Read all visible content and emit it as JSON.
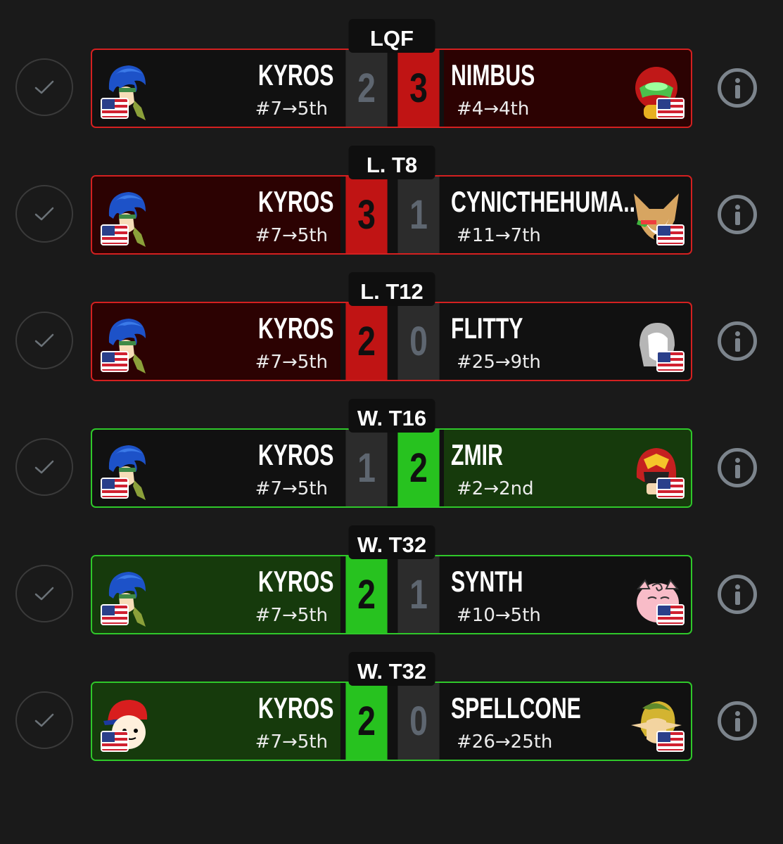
{
  "matches": [
    {
      "round": "LQF",
      "result": "loss",
      "p1": {
        "name": "KYROS",
        "seed": "#7→5th",
        "character": "ike-icon"
      },
      "p2": {
        "name": "NIMBUS",
        "seed": "#4→4th",
        "character": "samus-icon"
      },
      "score1": "2",
      "score2": "3"
    },
    {
      "round": "L. T8",
      "result": "win",
      "p1": {
        "name": "KYROS",
        "seed": "#7→5th",
        "character": "ike-icon"
      },
      "p2": {
        "name": "CYNICTHEHUMA...",
        "seed": "#11→7th",
        "character": "fox-icon"
      },
      "score1": "3",
      "score2": "1"
    },
    {
      "round": "L. T12",
      "result": "win",
      "p1": {
        "name": "KYROS",
        "seed": "#7→5th",
        "character": "ike-icon"
      },
      "p2": {
        "name": "FLITTY",
        "seed": "#25→9th",
        "character": "mii-icon"
      },
      "score1": "2",
      "score2": "0"
    },
    {
      "round": "W. T16",
      "result": "loss",
      "p1": {
        "name": "KYROS",
        "seed": "#7→5th",
        "character": "ike-icon"
      },
      "p2": {
        "name": "ZMIR",
        "seed": "#2→2nd",
        "character": "captain-falcon-icon"
      },
      "score1": "1",
      "score2": "2"
    },
    {
      "round": "W. T32",
      "result": "win",
      "p1": {
        "name": "KYROS",
        "seed": "#7→5th",
        "character": "ike-icon"
      },
      "p2": {
        "name": "SYNTH",
        "seed": "#10→5th",
        "character": "jigglypuff-icon"
      },
      "score1": "2",
      "score2": "1"
    },
    {
      "round": "W. T32",
      "result": "win",
      "p1": {
        "name": "KYROS",
        "seed": "#7→5th",
        "character": "ness-icon"
      },
      "p2": {
        "name": "SPELLCONE",
        "seed": "#26→25th",
        "character": "link-icon"
      },
      "score1": "2",
      "score2": "0"
    }
  ],
  "colors": {
    "background": "#1a1a1a",
    "loss_accent": "#c01414",
    "win_accent": "#27c21f",
    "neutral_score": "#5e6670"
  },
  "icons": {
    "flag": "us-flag-icon",
    "check": "check-icon",
    "info": "info-icon"
  }
}
